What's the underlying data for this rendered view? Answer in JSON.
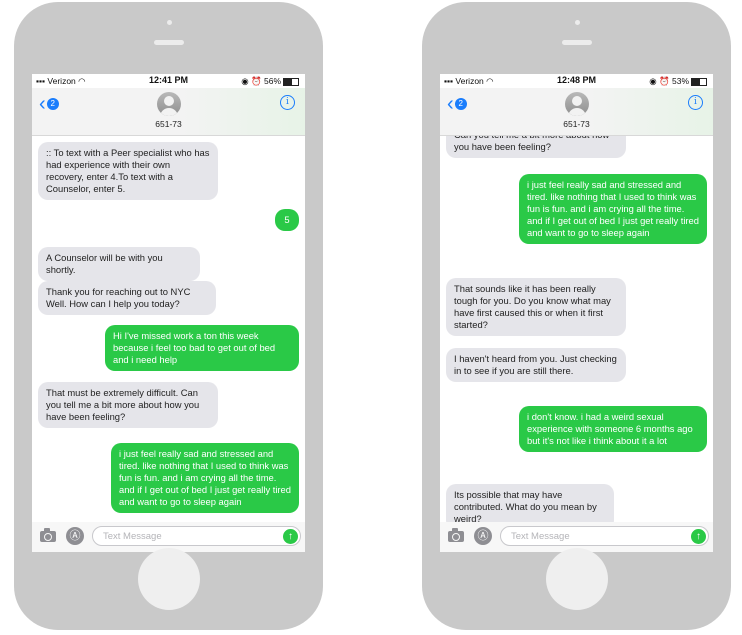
{
  "phones": [
    {
      "status": {
        "carrier": "Verizon",
        "time": "12:41 PM",
        "battery": "56%"
      },
      "nav": {
        "back_count": "2",
        "contact": "651-73",
        "info_glyph": "i"
      },
      "input_placeholder": "Text Message",
      "messages": [
        {
          "dir": "in",
          "text": ":: To text with a Peer specialist who has had experience with their own recovery, enter 4.To text with a Counselor, enter 5."
        },
        {
          "dir": "out",
          "text": "5"
        },
        {
          "dir": "in",
          "text": "A Counselor will be with you shortly."
        },
        {
          "dir": "in",
          "text": "Thank you for reaching out to NYC Well. How can I help you today?"
        },
        {
          "dir": "out",
          "text": "Hi I've missed work a ton this week because i feel too bad to get out of bed and i need help"
        },
        {
          "dir": "in",
          "text": "That must be extremely difficult. Can you tell me a bit more about how you have been feeling?"
        },
        {
          "dir": "out",
          "text": "i just feel really sad and stressed and tired. like nothing that I used to think was fun is fun. and i am crying all the time. and if I get out of bed I just get really tired and want to go to sleep again"
        }
      ]
    },
    {
      "status": {
        "carrier": "Verizon",
        "time": "12:48 PM",
        "battery": "53%"
      },
      "nav": {
        "back_count": "2",
        "contact": "651-73",
        "info_glyph": "i"
      },
      "input_placeholder": "Text Message",
      "messages": [
        {
          "dir": "in",
          "text": "Can you tell me a bit more about how you have been feeling?"
        },
        {
          "dir": "out",
          "text": "i just feel really sad and stressed and tired. like nothing that I used to think was fun is fun. and i am crying all the time. and if I get out of bed I just get really tired and want to go to sleep again"
        },
        {
          "dir": "in",
          "text": "That sounds like it has been really tough for you. Do you know what may have first caused this or when it first started?"
        },
        {
          "dir": "in",
          "text": "I haven't heard from you. Just checking in to see if you are still there."
        },
        {
          "dir": "out",
          "text": "i don't know. i had a weird sexual experience with someone 6 months ago but it's not like i think about it a lot"
        },
        {
          "dir": "in",
          "text": "Its possible that may have contributed. What do you mean by weird?"
        }
      ]
    }
  ]
}
